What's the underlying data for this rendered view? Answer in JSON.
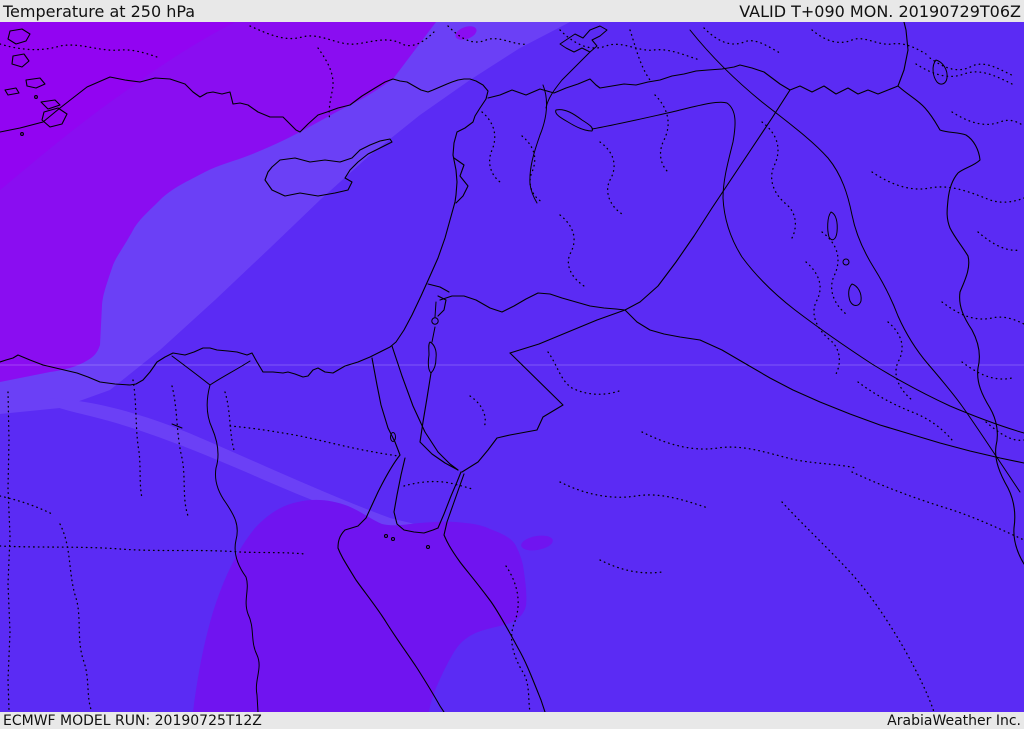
{
  "header": {
    "title": "Temperature at 250 hPa",
    "valid_time": "VALID T+090 MON. 20190729T06Z"
  },
  "footer": {
    "model_run": "ECMWF MODEL RUN: 20190725T12Z",
    "credit": "ArabiaWeather Inc."
  },
  "map": {
    "kind": "temperature-fill weather map, Middle East / Eastern Mediterranean region",
    "colors": {
      "base_violet": "#5b2bf4",
      "light_violet_band": "#6b40f6",
      "vivid_purple_band": "#8a0df1",
      "corner_magenta_band": "#9204f2",
      "mid_purple_band": "#7014f0",
      "line_color": "#000000",
      "gridline": "rgba(255,255,255,0.22)",
      "bar_background": "#e8e8e8",
      "bar_text": "#111111"
    }
  }
}
